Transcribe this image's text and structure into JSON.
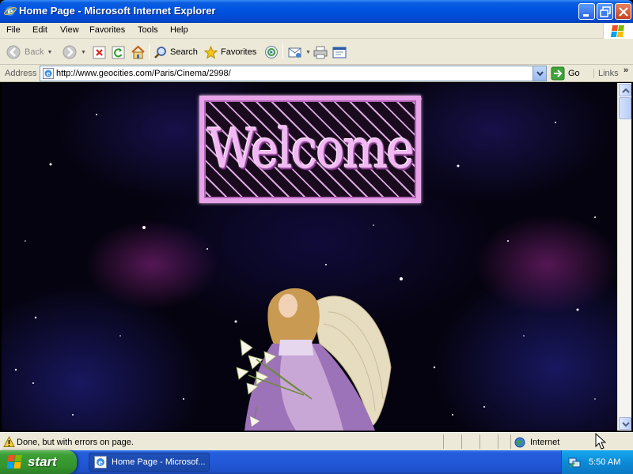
{
  "window": {
    "title": "Home Page - Microsoft Internet Explorer",
    "controls": [
      "minimize",
      "maximize",
      "close"
    ]
  },
  "menu": {
    "items": [
      "File",
      "Edit",
      "View",
      "Favorites",
      "Tools",
      "Help"
    ]
  },
  "toolbar": {
    "back_label": "Back",
    "search_label": "Search",
    "favorites_label": "Favorites"
  },
  "address": {
    "label": "Address",
    "url": "http://www.geocities.com/Paris/Cinema/2998/",
    "go_label": "Go",
    "links_label": "Links"
  },
  "page": {
    "banner_text": "Welcome"
  },
  "status": {
    "text": "Done, but with errors on page.",
    "zone": "Internet"
  },
  "taskbar": {
    "start_label": "start",
    "task_label": "Home Page - Microsof...",
    "clock": "5:50 AM"
  },
  "colors": {
    "title_blue": "#0054e3",
    "chrome": "#ece9d8",
    "start_green": "#3c9e35",
    "banner_pink": "#e7a3e8"
  }
}
